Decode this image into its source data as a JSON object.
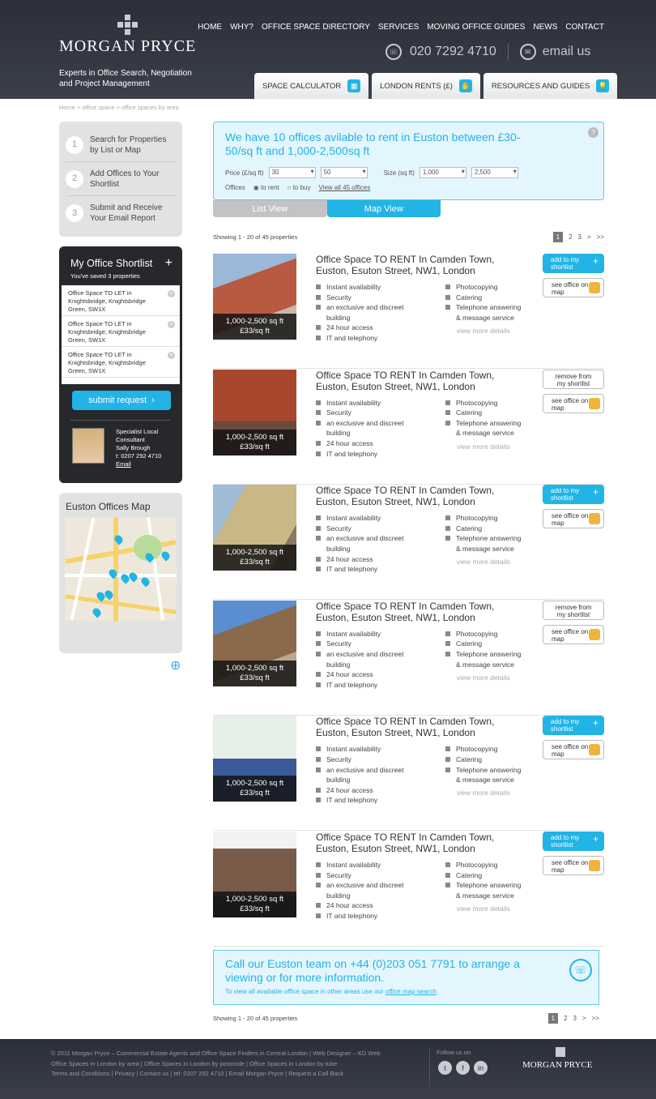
{
  "header": {
    "logo": "MORGAN PRYCE",
    "tagline": "Experts in Office Search, Negotiation and Project Management",
    "nav": [
      "HOME",
      "WHY?",
      "OFFICE SPACE DIRECTORY",
      "SERVICES",
      "MOVING OFFICE GUIDES",
      "NEWS",
      "CONTACT"
    ],
    "phone": "020 7292 4710",
    "email": "email us",
    "tabs": [
      "SPACE CALCULATOR",
      "LONDON RENTS (£)",
      "RESOURCES AND GUIDES"
    ]
  },
  "breadcrumb": "Home > office space > office spaces by area",
  "steps": [
    {
      "num": "1",
      "label": "Search for Properties by List or Map"
    },
    {
      "num": "2",
      "label": "Add Offices to Your Shortlist"
    },
    {
      "num": "3",
      "label": "Submit and Receive Your Email Report"
    }
  ],
  "shortlist": {
    "title": "My Office Shortlist",
    "subtitle": "You've saved 3 properties",
    "items": [
      "Office Space TO LET in Knightsbridge, Knightsbridge Green, SW1X",
      "Office Space TO LET in Knightsbridge, Knightsbridge Green, SW1X",
      "Office Space TO LET in Knightsbridge, Knightsbridge Green, SW1X"
    ],
    "submit": "submit request",
    "specialist": {
      "role": "Specialist Local Consultant",
      "name": "Sally Brough",
      "phone": "t: 0207 292 4710",
      "email": "Email"
    }
  },
  "map": {
    "title": "Euston Offices Map"
  },
  "search": {
    "headline": "We have 10 offices avilable to rent in Euston between £30-50/sq ft and 1,000-2,500sq ft",
    "price_label": "Price (£/sq ft)",
    "price_min": "30",
    "price_max": "50",
    "size_label": "Size (sq ft)",
    "size_min": "1,000",
    "size_max": "2,500",
    "offices_label": "Offices",
    "to_rent": "to rent",
    "to_buy": "to buy",
    "view_all": "View all 45 offices"
  },
  "views": {
    "list": "List View",
    "map": "Map View"
  },
  "showing": "Showing 1 - 20 of 45 properties",
  "pager": [
    "1",
    "2",
    "3",
    ">",
    ">>"
  ],
  "listings": [
    {
      "title": "Office Space TO RENT In Camden Town, Euston, Esuton Street, NW1, London",
      "size": "1,000-2,500 sq ft",
      "price": "£33/sq ft",
      "action": "add to my shortlist",
      "action_type": "add"
    },
    {
      "title": "Office Space TO RENT In Camden Town, Euston, Esuton Street, NW1, London",
      "size": "1,000-2,500 sq ft",
      "price": "£33/sq ft",
      "action": "remove from my shortlist",
      "action_type": "rem"
    },
    {
      "title": "Office Space TO RENT In Camden Town, Euston, Esuton Street, NW1, London",
      "size": "1,000-2,500 sq ft",
      "price": "£33/sq ft",
      "action": "add to my shortlist",
      "action_type": "add"
    },
    {
      "title": "Office Space TO RENT In Camden Town, Euston, Esuton Street, NW1, London",
      "size": "1,000-2,500 sq ft",
      "price": "£33/sq ft",
      "action": "remove from my shortlist",
      "action_type": "rem"
    },
    {
      "title": "Office Space TO RENT In Camden Town, Euston, Esuton Street, NW1, London",
      "size": "1,000-2,500 sq ft",
      "price": "£33/sq ft",
      "action": "add to my shortlist",
      "action_type": "add"
    },
    {
      "title": "Office Space TO RENT In Camden Town, Euston, Esuton Street, NW1, London",
      "size": "1,000-2,500 sq ft",
      "price": "£33/sq ft",
      "action": "add to my shortlist",
      "action_type": "add"
    }
  ],
  "features_left": [
    "Instant availability",
    "Security",
    "an exclusive and discreet",
    "building",
    "24 hour access",
    "IT and telephony"
  ],
  "features_right": [
    "Photocopying",
    "Catering",
    "Telephone answering",
    "& message service"
  ],
  "view_more": "view more details",
  "map_btn": "see office on map",
  "call": {
    "text": "Call our Euston team on +44 (0)203 051 7791 to arrange a viewing or for more information.",
    "sub": "To view all available office space in other areas use our",
    "link": "office map search"
  },
  "footer": {
    "lines": [
      "© 2011 Morgan Pryce – Commercial Estate Agents and Office Space Finders in Central London | Web Designer – KD Web",
      "Office Spaces in London by area | Office Spaces in London by postcode | Office Spaces in London by tube",
      "Terms and Conditions | Privacy | Contact us | tel: 0207 292 4710 | Email Morgan Pryce | Request a Call Back"
    ],
    "follow": "Follow us on",
    "logo": "MORGAN PRYCE"
  },
  "colors": {
    "accent": "#21b4e5",
    "header_bg": "#2a2f3a"
  }
}
